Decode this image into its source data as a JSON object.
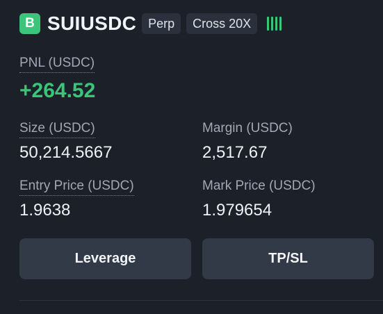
{
  "colors": {
    "background": "#1b2029",
    "positive": "#3cc57a",
    "label": "#a2a9b4",
    "button": "#323a47"
  },
  "header": {
    "side_badge": "B",
    "symbol": "SUIUSDC",
    "market_type": "Perp",
    "margin_mode": "Cross 20X",
    "signal_icon": "signal-bars-icon"
  },
  "pnl": {
    "label": "PNL (USDC)",
    "value": "+264.52"
  },
  "fields": {
    "size": {
      "label": "Size (USDC)",
      "value": "50,214.5667"
    },
    "margin": {
      "label": "Margin (USDC)",
      "value": "2,517.67"
    },
    "entry_price": {
      "label": "Entry Price (USDC)",
      "value": "1.9638"
    },
    "mark_price": {
      "label": "Mark Price (USDC)",
      "value": "1.979654"
    }
  },
  "buttons": {
    "leverage": "Leverage",
    "tpsl": "TP/SL"
  }
}
